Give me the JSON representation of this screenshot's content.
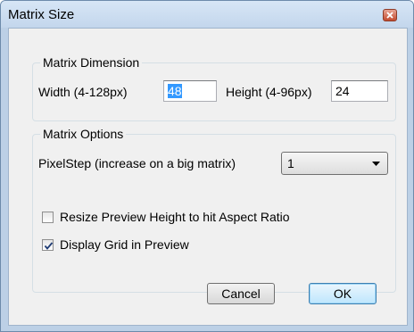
{
  "window": {
    "title": "Matrix Size"
  },
  "matrix_dimension": {
    "legend": "Matrix Dimension",
    "width_label": "Width (4-128px)",
    "width_value": "48",
    "height_label": "Height (4-96px)",
    "height_value": "24"
  },
  "matrix_options": {
    "legend": "Matrix Options",
    "pixelstep_label": "PixelStep (increase on a big matrix)",
    "pixelstep_value": "1",
    "resize_preview_label": "Resize Preview Height to hit Aspect Ratio",
    "resize_preview_checked": false,
    "display_grid_label": "Display Grid in Preview",
    "display_grid_checked": true
  },
  "buttons": {
    "cancel": "Cancel",
    "ok": "OK"
  },
  "icons": {
    "close": "close-icon",
    "dropdown": "chevron-down-icon",
    "check": "checkmark-icon"
  }
}
